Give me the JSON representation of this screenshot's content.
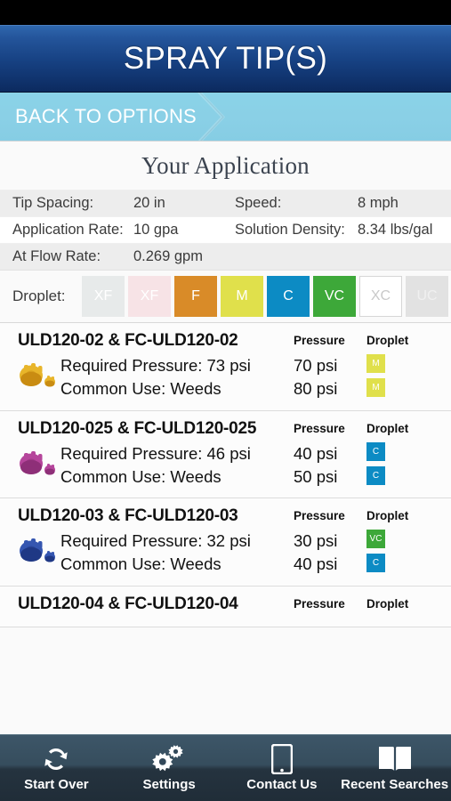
{
  "statusbar": {
    "left": "",
    "right": ""
  },
  "header": {
    "title": "SPRAY TIP(S)"
  },
  "nav": {
    "back_label": "BACK TO OPTIONS",
    "chevron_icon": "chevron-right-icon"
  },
  "application": {
    "title": "Your Application",
    "rows": [
      {
        "label1": "Tip Spacing:",
        "value1": "20 in",
        "label2": "Speed:",
        "value2": "8 mph"
      },
      {
        "label1": "Application Rate:",
        "value1": "10 gpa",
        "label2": "Solution Density:",
        "value2": "8.34 lbs/gal"
      },
      {
        "label1": "At Flow Rate:",
        "value1": "0.269 gpm",
        "label2": "",
        "value2": ""
      }
    ]
  },
  "droplet_selector": {
    "label": "Droplet:",
    "chips": [
      {
        "code": "XF",
        "bg": "#e7eaea",
        "fg": "#ffffff",
        "selected": false
      },
      {
        "code": "XF",
        "bg": "#f7e3e6",
        "fg": "#ffffff",
        "selected": false
      },
      {
        "code": "F",
        "bg": "#d98b28",
        "fg": "#ffffff",
        "selected": true
      },
      {
        "code": "M",
        "bg": "#e0e04b",
        "fg": "#ffffff",
        "selected": true
      },
      {
        "code": "C",
        "bg": "#0c8bc4",
        "fg": "#ffffff",
        "selected": true
      },
      {
        "code": "VC",
        "bg": "#3da839",
        "fg": "#ffffff",
        "selected": true
      },
      {
        "code": "XC",
        "bg": "#ffffff",
        "fg": "#c9c9c9",
        "selected": false
      },
      {
        "code": "UC",
        "bg": "#e2e2e2",
        "fg": "#f0f0f0",
        "selected": false
      }
    ]
  },
  "results": {
    "col_pressure": "Pressure",
    "col_droplet": "Droplet",
    "items": [
      {
        "name": "ULD120-02 & FC-ULD120-02",
        "icon": "nozzle-icon-yellow",
        "icon_color": "#e8b52a",
        "icon_color_dark": "#c98c12",
        "required_pressure": "Required Pressure: 73 psi",
        "common_use": "Common Use: Weeds",
        "pressures": [
          "70 psi",
          "80 psi"
        ],
        "droplets": [
          {
            "code": "M",
            "bg": "#e0e04b"
          },
          {
            "code": "M",
            "bg": "#e0e04b"
          }
        ]
      },
      {
        "name": "ULD120-025 & FC-ULD120-025",
        "icon": "nozzle-icon-magenta",
        "icon_color": "#b5459b",
        "icon_color_dark": "#8e2f78",
        "required_pressure": "Required Pressure: 46 psi",
        "common_use": "Common Use: Weeds",
        "pressures": [
          "40 psi",
          "50 psi"
        ],
        "droplets": [
          {
            "code": "C",
            "bg": "#0c8bc4"
          },
          {
            "code": "C",
            "bg": "#0c8bc4"
          }
        ]
      },
      {
        "name": "ULD120-03 & FC-ULD120-03",
        "icon": "nozzle-icon-blue",
        "icon_color": "#3556b0",
        "icon_color_dark": "#1f3885",
        "required_pressure": "Required Pressure: 32 psi",
        "common_use": "Common Use: Weeds",
        "pressures": [
          "30 psi",
          "40 psi"
        ],
        "droplets": [
          {
            "code": "VC",
            "bg": "#3da839"
          },
          {
            "code": "C",
            "bg": "#0c8bc4"
          }
        ]
      },
      {
        "name": "ULD120-04 & FC-ULD120-04",
        "icon": "nozzle-icon-red",
        "icon_color": "#c23a2f",
        "icon_color_dark": "#93251c",
        "required_pressure": "",
        "common_use": "",
        "pressures": [],
        "droplets": []
      }
    ]
  },
  "tabbar": {
    "items": [
      {
        "label": "Start Over",
        "icon": "refresh-cycle-icon"
      },
      {
        "label": "Settings",
        "icon": "gears-icon"
      },
      {
        "label": "Contact Us",
        "icon": "phone-icon"
      },
      {
        "label": "Recent Searches",
        "icon": "open-book-icon"
      }
    ]
  }
}
